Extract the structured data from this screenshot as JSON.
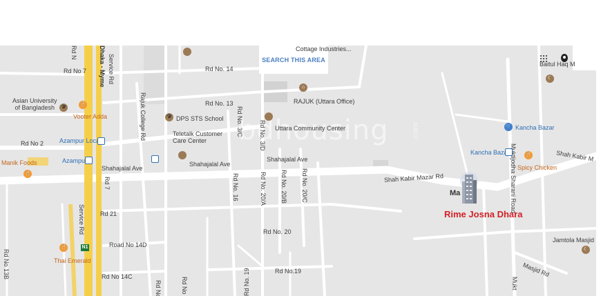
{
  "search_button": "SEARCH THIS AREA",
  "property": {
    "name": "Rime Josna Dhara",
    "logo_text": "Ma"
  },
  "watermark": {
    "text": "bdhousing",
    "suffix": ".com"
  },
  "highway_shield": "N1",
  "roads": {
    "dhaka_mymensingh": "Dhaka - Myme",
    "service_rd": "Service Rd",
    "service_rd_2": "Service Rd",
    "rd7_horizontal": "Rd No 7",
    "rd_n": "Rd N",
    "rd2": "Rd No 2",
    "rd7_vertical": "Rd 7",
    "rd21": "Rd 21",
    "road14d": "Road No 14D",
    "rd14c": "Rd No 14C",
    "rd13b": "Rd No 13B",
    "rd14": "Rd No. 14",
    "rd13": "Rd No. 13",
    "rajuk_college": "Rajuk College Rd",
    "shahajalal_1": "Shahajalal Ave",
    "shahajalal_2": "Shahajalal Ave",
    "shahajalal_3": "Shahajalal Ave",
    "rd3c": "Rd No. 3/C",
    "rd3d": "Rd No. 3/D",
    "rd16": "Rd No. 16",
    "rd20a": "Rd No. 20/A",
    "rd20b": "Rd No. 20/B",
    "rd20c": "Rd No. 20/C",
    "rd20": "Rd No. 20",
    "rd19": "Rd No. 19",
    "rdno19": "Rd No.19",
    "rd_no_left": "Rd No",
    "rd_no_mid": "Rd No",
    "shah_kabir_mazar": "Shah Kabir Mazar Rd",
    "shah_kabir_m": "Shah Kabir M",
    "muktijodha": "Muktijodha Sharani Road",
    "mukt": "Mukt",
    "masjid_rd": "Masjid Rd"
  },
  "places": {
    "asian_university": "Asian University\nof Bangladesh",
    "vooter_adda": "Vooter Adda",
    "azampur_local": "Azampur Local",
    "azampur": "Azampur",
    "manik_foods": "Manik Foods",
    "dps_sts": "DPS STS School",
    "teletalk": "Teletalk Customer\nCare Center",
    "rajuk": "RAJUK (Uttara Office)",
    "uttara_cc": "Uttara Community Center",
    "cottage": "Cottage Industries...",
    "baitul": "Baitul Haq M",
    "kancha_bazar": "Kancha Bazar",
    "kancha_bazar_stn": "Kancha Bazar",
    "spicy_chicken": "Spicy Chicken",
    "jamtola": "Jamtola Masjid",
    "thai_emerald": "Thai Emerald"
  },
  "colors": {
    "map_bg": "#e6e6e6",
    "road": "#ffffff",
    "highway": "#f6cf4a",
    "marker_text": "#d21f26",
    "station": "#2f6fb5",
    "poi_food": "#f29a35",
    "poi_place": "#9b7a56"
  }
}
